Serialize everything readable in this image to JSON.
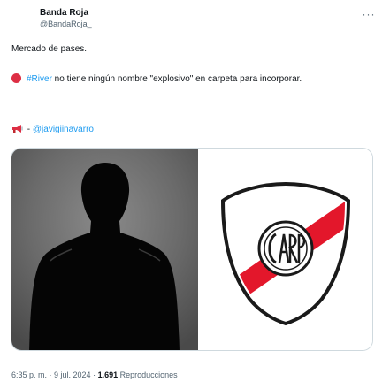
{
  "author": {
    "name": "Banda Roja",
    "handle": "@BandaRoja_"
  },
  "tweet": {
    "line1": "Mercado de pases.",
    "hashtag": "#River",
    "line2_rest": " no tiene ningún nombre \"explosivo\" en carpeta para incorporar.",
    "source_prefix": " - ",
    "mention": "@javigiinavarro"
  },
  "meta": {
    "time": "6:35 p. m.",
    "sep1": " · ",
    "date": "9 jul. 2024",
    "sep2": " · ",
    "views_count": "1.691",
    "views_label": " Reproducciones"
  },
  "colors": {
    "link": "#1d9bf0",
    "river_red": "#e3172b",
    "text": "#0f1419",
    "secondary": "#536471"
  },
  "icons": {
    "more": "ellipsis-horizontal",
    "red_circle": "red-circle-emoji",
    "megaphone": "megaphone-emoji"
  }
}
